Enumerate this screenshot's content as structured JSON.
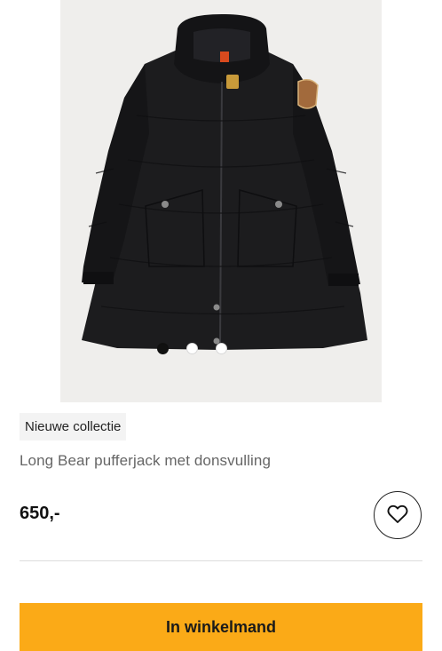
{
  "product": {
    "badge": "Nieuwe collectie",
    "name": "Long Bear pufferjack met donsvulling",
    "price": "650,-",
    "wishlist_icon": "heart-icon",
    "image_alt": "black long puffer jacket with hood"
  },
  "gallery": {
    "image_count": 3,
    "active_index": 0
  },
  "actions": {
    "add_to_cart_label": "In winkelmand"
  },
  "colors": {
    "accent": "#fbaa17",
    "photo_background": "#efeeec",
    "jacket": "#1c1c1e"
  }
}
